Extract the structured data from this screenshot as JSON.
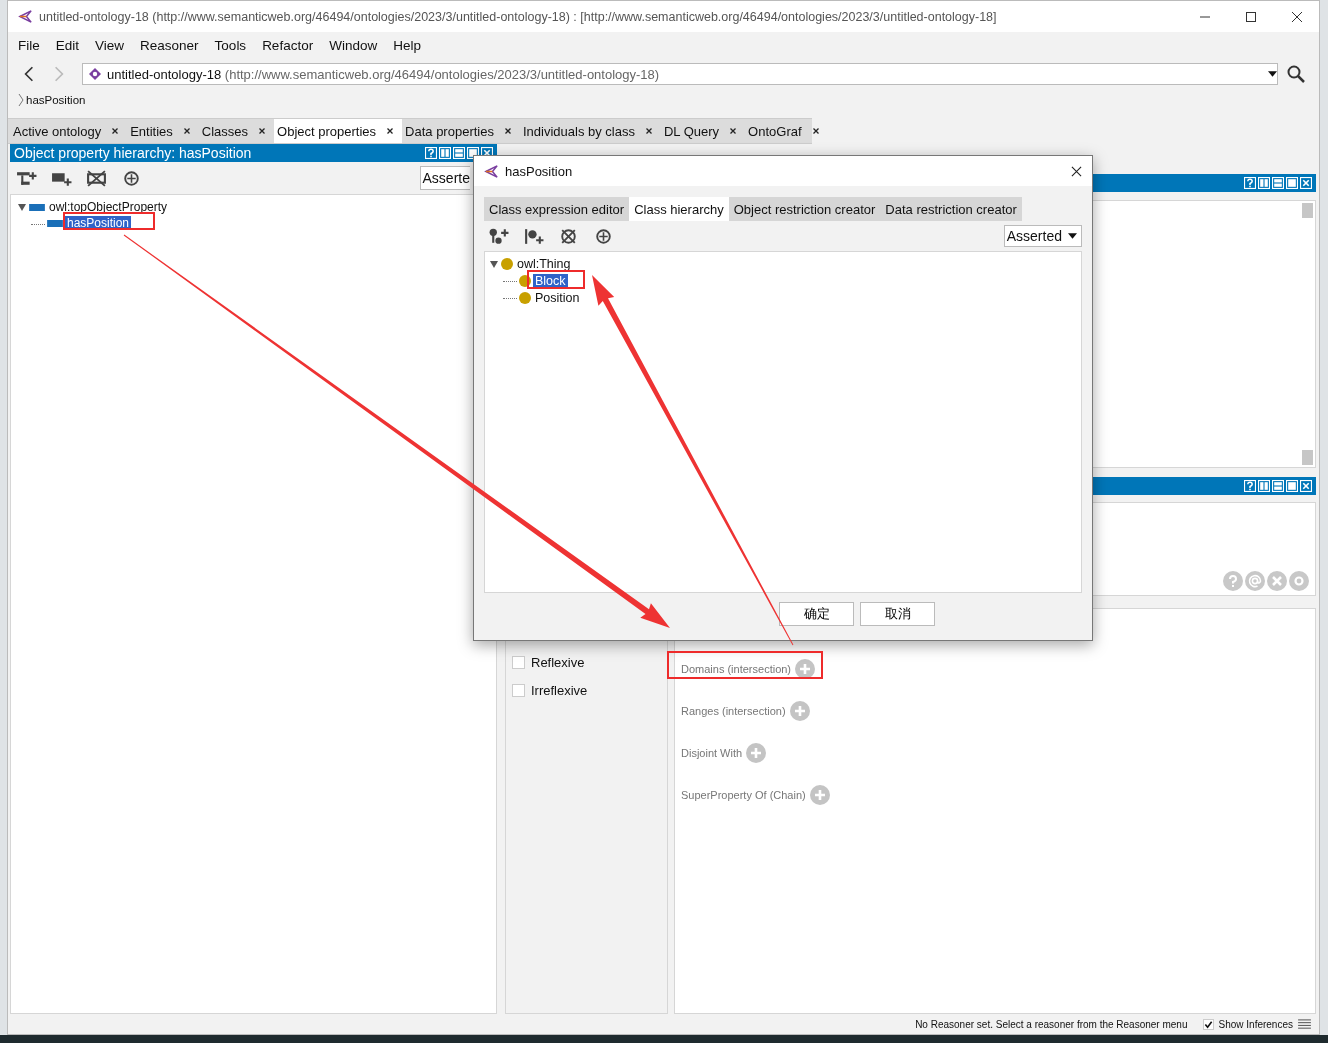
{
  "window": {
    "title": "untitled-ontology-18 (http://www.semanticweb.org/46494/ontologies/2023/3/untitled-ontology-18)  : [http://www.semanticweb.org/46494/ontologies/2023/3/untitled-ontology-18]"
  },
  "menu": [
    "File",
    "Edit",
    "View",
    "Reasoner",
    "Tools",
    "Refactor",
    "Window",
    "Help"
  ],
  "address": {
    "name": "untitled-ontology-18",
    "iri": "(http://www.semanticweb.org/46494/ontologies/2023/3/untitled-ontology-18)"
  },
  "breadcrumb": "hasPosition",
  "tabs": [
    {
      "label": "Active ontology",
      "selected": false
    },
    {
      "label": "Entities",
      "selected": false
    },
    {
      "label": "Classes",
      "selected": false
    },
    {
      "label": "Object properties",
      "selected": true
    },
    {
      "label": "Data properties",
      "selected": false
    },
    {
      "label": "Individuals by class",
      "selected": false
    },
    {
      "label": "DL Query",
      "selected": false
    },
    {
      "label": "OntoGraf",
      "selected": false
    }
  ],
  "hierarchy_panel": {
    "title": "Object property hierarchy: hasPosition",
    "mode": "Asserte",
    "tree": [
      {
        "label": "owl:topObjectProperty",
        "expanded": true,
        "selected": false,
        "children": [
          {
            "label": "hasPosition",
            "selected": true
          }
        ]
      }
    ]
  },
  "characteristics": [
    {
      "label": "Reflexive",
      "checked": false
    },
    {
      "label": "Irreflexive",
      "checked": false
    }
  ],
  "description_sections": [
    "Domains (intersection)",
    "Ranges (intersection)",
    "Disjoint With",
    "SuperProperty Of (Chain)"
  ],
  "status_bar": {
    "message": "No Reasoner set. Select a reasoner from the Reasoner menu",
    "show_inferences": {
      "label": "Show Inferences",
      "checked": true
    }
  },
  "dialog": {
    "title": "hasPosition",
    "tabs": [
      {
        "label": "Class expression editor",
        "selected": false
      },
      {
        "label": "Class hierarchy",
        "selected": true
      },
      {
        "label": "Object restriction creator",
        "selected": false
      },
      {
        "label": "Data restriction creator",
        "selected": false
      }
    ],
    "mode": "Asserted",
    "tree": [
      {
        "label": "owl:Thing",
        "expanded": true,
        "selected": false,
        "children": [
          {
            "label": "Block",
            "selected": true
          },
          {
            "label": "Position",
            "selected": false
          }
        ]
      }
    ],
    "buttons": [
      "确定",
      "取消"
    ]
  }
}
